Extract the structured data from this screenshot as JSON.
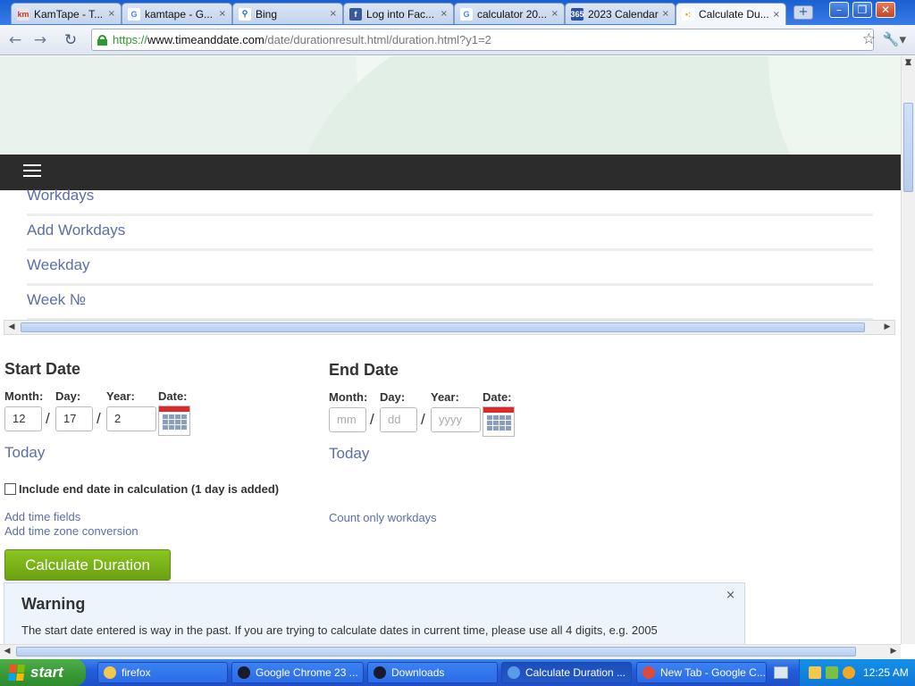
{
  "browser": {
    "tabs": [
      {
        "label": "KamTape - T...",
        "icon": "kamtape-icon",
        "fav_text": "km",
        "fav_bg": "#e6e6e6",
        "fav_color": "#c33"
      },
      {
        "label": "kamtape - G...",
        "icon": "google-icon",
        "fav_text": "G",
        "fav_bg": "#ffffff",
        "fav_color": "#4285f4"
      },
      {
        "label": "Bing",
        "icon": "search-icon",
        "fav_text": "⚲",
        "fav_bg": "#ffffff",
        "fav_color": "#1e5bc6"
      },
      {
        "label": "Log into Fac...",
        "icon": "facebook-icon",
        "fav_text": "f",
        "fav_bg": "#3b5998",
        "fav_color": "#ffffff"
      },
      {
        "label": "calculator 20...",
        "icon": "google-icon",
        "fav_text": "G",
        "fav_bg": "#ffffff",
        "fav_color": "#4285f4"
      },
      {
        "label": "2023 Calendar",
        "icon": "calendar-365-icon",
        "fav_text": "365",
        "fav_bg": "#2a4fa8",
        "fav_color": "#ffffff"
      },
      {
        "label": "Calculate Du...",
        "icon": "timeanddate-icon",
        "fav_text": "•:",
        "fav_bg": "#ffffff",
        "fav_color": "#e3a21a",
        "active": true
      }
    ],
    "new_tab": "+",
    "window_controls": {
      "minimize": "–",
      "maximize": "❐",
      "close": "✕"
    },
    "address": {
      "scheme": "https://",
      "host": "www.timeanddate.com",
      "path": "/date/durationresult.html/duration.html?y1=2"
    }
  },
  "page": {
    "menu_items": [
      "Workdays",
      "Add Workdays",
      "Weekday",
      "Week №"
    ],
    "start": {
      "title": "Start Date",
      "labels": {
        "month": "Month:",
        "day": "Day:",
        "year": "Year:",
        "date": "Date:"
      },
      "month": "12",
      "day": "17",
      "year": "2",
      "today": "Today"
    },
    "end": {
      "title": "End Date",
      "labels": {
        "month": "Month:",
        "day": "Day:",
        "year": "Year:",
        "date": "Date:"
      },
      "month_placeholder": "mm",
      "day_placeholder": "dd",
      "year_placeholder": "yyyy",
      "today": "Today"
    },
    "separator": "/",
    "include_end_label": "Include end date in calculation (1 day is added)",
    "add_time_fields": "Add time fields",
    "add_time_zone": "Add time zone conversion",
    "count_workdays": "Count only workdays",
    "calculate_button": "Calculate Duration",
    "warning": {
      "title": "Warning",
      "close": "×",
      "text": "The start date entered is way in the past. If you are trying to calculate dates in current time, please use all 4 digits, e.g. 2005"
    }
  },
  "taskbar": {
    "start_label": "start",
    "tasks": [
      {
        "label": "firefox",
        "icon": "folder-icon",
        "color": "#f2c94c"
      },
      {
        "label": "Google Chrome 23 ...",
        "icon": "chrome-icon",
        "color": "#1a1a2e"
      },
      {
        "label": "Downloads",
        "icon": "downloads-icon",
        "color": "#1a1a2e"
      },
      {
        "label": "Calculate Duration ...",
        "icon": "ie-icon",
        "color": "#5a9be8",
        "active": true
      },
      {
        "label": "New Tab - Google C...",
        "icon": "chrome-icon",
        "color": "#e04a3a"
      }
    ],
    "clock": "12:25 AM"
  },
  "colors": {
    "accent_link": "#5a6fa8",
    "calc_button": "#7ab317",
    "navbar": "#2c2c2c"
  }
}
